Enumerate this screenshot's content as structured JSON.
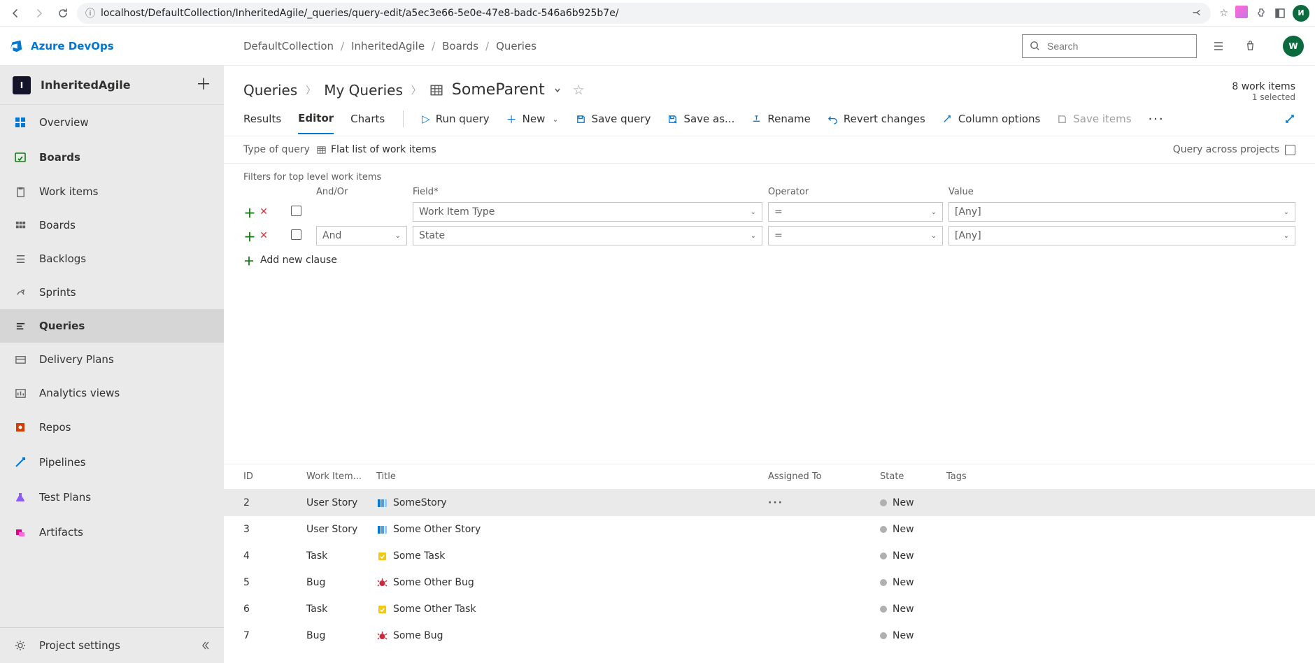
{
  "browser": {
    "url": "localhost/DefaultCollection/InheritedAgile/_queries/query-edit/a5ec3e66-5e0e-47e8-badc-546a6b925b7e/",
    "avatar_letter": "И"
  },
  "product": {
    "name": "Azure DevOps",
    "breadcrumb": [
      "DefaultCollection",
      "InheritedAgile",
      "Boards",
      "Queries"
    ],
    "search_placeholder": "Search",
    "avatar_letter": "W"
  },
  "project": {
    "badge": "I",
    "name": "InheritedAgile"
  },
  "nav": {
    "overview": "Overview",
    "boards": "Boards",
    "work_items": "Work items",
    "boards_sub": "Boards",
    "backlogs": "Backlogs",
    "sprints": "Sprints",
    "queries": "Queries",
    "delivery": "Delivery Plans",
    "analytics": "Analytics views",
    "repos": "Repos",
    "pipelines": "Pipelines",
    "test_plans": "Test Plans",
    "artifacts": "Artifacts",
    "settings": "Project settings"
  },
  "page": {
    "bc1": "Queries",
    "bc2": "My Queries",
    "bc3": "SomeParent",
    "count_label": "8 work items",
    "selected_label": "1 selected"
  },
  "tabs": {
    "results": "Results",
    "editor": "Editor",
    "charts": "Charts"
  },
  "toolbar": {
    "run": "Run query",
    "new": "New",
    "save": "Save query",
    "saveas": "Save as...",
    "rename": "Rename",
    "revert": "Revert changes",
    "columns": "Column options",
    "saveitems": "Save items"
  },
  "qtype": {
    "label": "Type of query",
    "value": "Flat list of work items",
    "cross": "Query across projects"
  },
  "filters": {
    "label": "Filters for top level work items",
    "head": {
      "andor": "And/Or",
      "field": "Field*",
      "operator": "Operator",
      "value": "Value"
    },
    "rows": [
      {
        "andor": "",
        "field": "Work Item Type",
        "operator": "=",
        "value": "[Any]"
      },
      {
        "andor": "And",
        "field": "State",
        "operator": "=",
        "value": "[Any]"
      }
    ],
    "add_clause": "Add new clause"
  },
  "results": {
    "columns": {
      "id": "ID",
      "type": "Work Item...",
      "title": "Title",
      "assigned": "Assigned To",
      "state": "State",
      "tags": "Tags"
    },
    "rows": [
      {
        "id": "2",
        "type": "User Story",
        "title": "SomeStory",
        "icon": "story",
        "state": "New",
        "selected": true
      },
      {
        "id": "3",
        "type": "User Story",
        "title": "Some Other Story",
        "icon": "story",
        "state": "New",
        "selected": false
      },
      {
        "id": "4",
        "type": "Task",
        "title": "Some Task",
        "icon": "task",
        "state": "New",
        "selected": false
      },
      {
        "id": "5",
        "type": "Bug",
        "title": "Some Other Bug",
        "icon": "bug",
        "state": "New",
        "selected": false
      },
      {
        "id": "6",
        "type": "Task",
        "title": "Some Other Task",
        "icon": "task",
        "state": "New",
        "selected": false
      },
      {
        "id": "7",
        "type": "Bug",
        "title": "Some Bug",
        "icon": "bug",
        "state": "New",
        "selected": false
      }
    ]
  }
}
